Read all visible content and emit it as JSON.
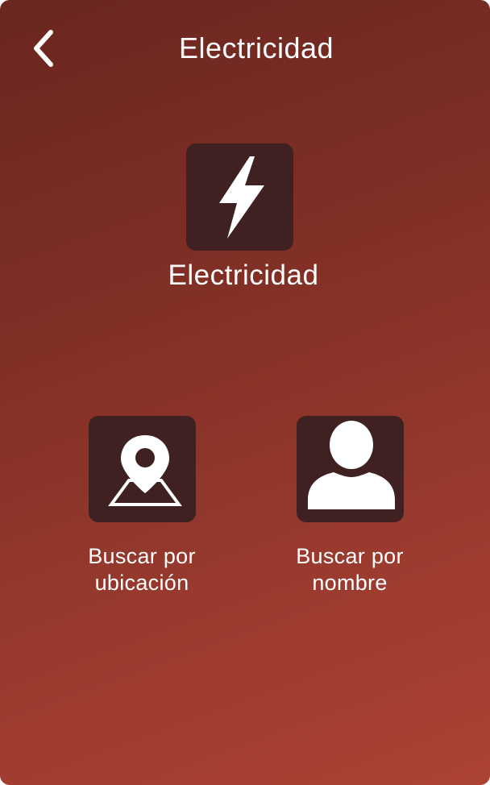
{
  "header": {
    "title": "Electricidad",
    "back_icon": "chevron-left-icon"
  },
  "category": {
    "icon": "lightning-bolt-icon",
    "label": "Electricidad"
  },
  "options": {
    "by_location": {
      "icon": "map-pin-icon",
      "label": "Buscar por\nubicación"
    },
    "by_name": {
      "icon": "user-silhouette-icon",
      "label": "Buscar por\nnombre"
    }
  },
  "colors": {
    "background_top": "#6a2620",
    "background_bottom": "#ad4233",
    "tile": "#3e2120",
    "foreground": "#ffffff"
  }
}
